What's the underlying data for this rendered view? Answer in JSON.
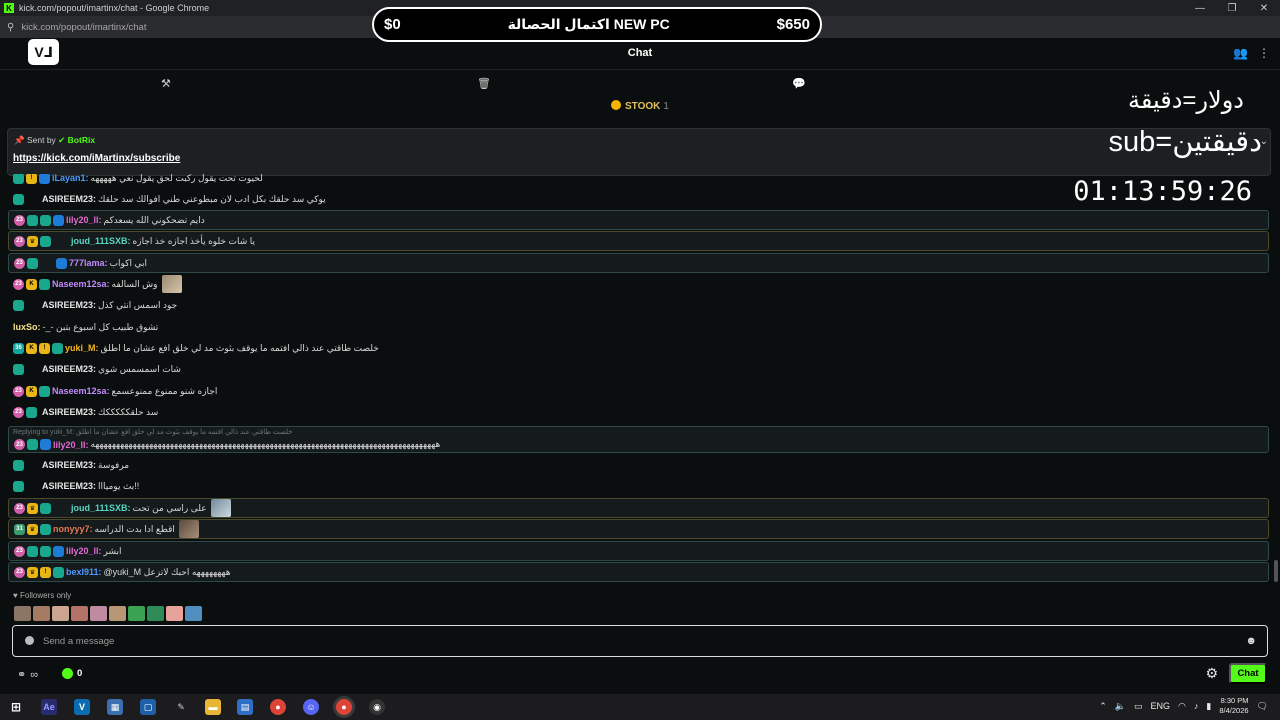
{
  "window": {
    "title": "kick.com/popout/imartinx/chat - Google Chrome",
    "url": "kick.com/popout/imartinx/chat"
  },
  "header": {
    "chat_title": "Chat"
  },
  "goal": {
    "left": "$0",
    "center": "اكتمال الحصالة NEW PC",
    "right": "$650"
  },
  "stock": {
    "label": "STOOK",
    "count": "1"
  },
  "pinned": {
    "sent_by_label": "Sent by",
    "bot_name": "BotRix",
    "link": "https://kick.com/iMartinx/subscribe"
  },
  "overlay": {
    "line1": "دولار=دقيقة",
    "line2": "sub=دقيقتين",
    "timer": "01:13:59:26"
  },
  "messages": [
    {
      "user": "iLayan1:",
      "text": "لحيوت تحت يقول ركبت لحق يقول نعي هههههه",
      "color": "#4f9cff"
    },
    {
      "user": "ASIREEM23:",
      "text": "يوكي سد حلقك بكل ادب لان مبطوعني طني افوالك سد حلقك",
      "color": "#e6e6e6"
    },
    {
      "user": "lily20_ll:",
      "text": "دايم تضحكوني الله يسعدكم",
      "color": "#e46ad2"
    },
    {
      "user": "joud_111SXB:",
      "text": "يا شات خلوه يأخذ اجازه خذ اجازه",
      "color": "#58d6c4"
    },
    {
      "user": "777lama:",
      "text": "ابي اكواب",
      "color": "#c18bff"
    },
    {
      "user": "Naseem12sa:",
      "text": "وش السالفه",
      "color": "#c18bff"
    },
    {
      "user": "ASIREEM23:",
      "text": "جود اسمس انتي كذل",
      "color": "#e6e6e6"
    },
    {
      "user": "luxSo:",
      "text": "-_- تشوق طبيب كل اسبوع بتبن",
      "color": "#f7e38b"
    },
    {
      "user": "yuki_M:",
      "text": "خلصت طاقتي عند ذالي افتمه ما يوقف بثوث مد لي خلق افع عشان ما اطلق",
      "color": "#f5b71a"
    },
    {
      "user": "ASIREEM23:",
      "text": "شات اسمسمس شوي",
      "color": "#e6e6e6"
    },
    {
      "user": "Naseem12sa:",
      "text": "اجازه شنو ممنوع ممنوعسمع",
      "color": "#c18bff"
    },
    {
      "user": "ASIREEM23:",
      "text": "سد حلقكككككك",
      "color": "#e6e6e6"
    },
    {
      "reply": "Replying to yuki_M: خلصت طاقتي عند ذالي افتمه ما يوقف بثوث مد لي خلق افع عشان ما اطلق"
    },
    {
      "user": "lily20_ll:",
      "text": "هههههههههههههههههههههههههههههههههههههههههههههههههههههههههههههههههههههههههههههههههههه",
      "color": "#e46ad2"
    },
    {
      "user": "ASIREEM23:",
      "text": "مرفوسة",
      "color": "#e6e6e6"
    },
    {
      "user": "ASIREEM23:",
      "text": "بث يوميااا!!",
      "color": "#e6e6e6"
    },
    {
      "user": "joud_111SXB:",
      "text": "على راسي من تحت",
      "color": "#58d6c4"
    },
    {
      "user": "nonyyy7:",
      "text": "اقطع ادا بدت الدراسه",
      "color": "#e67a52"
    },
    {
      "user": "lily20_ll:",
      "text": "ابشر",
      "color": "#e46ad2"
    },
    {
      "user": "bexl911:",
      "text": "@yuki_M  ههههههههه احبك لاتزعل",
      "color": "#4f9cff"
    }
  ],
  "footer": {
    "followers_only": "Followers only",
    "input_placeholder": "Send a message",
    "points": "0",
    "chat_button": "Chat"
  },
  "taskbar": {
    "lang": "ENG",
    "time": "8:30 PM",
    "date": "8/4/2026"
  }
}
